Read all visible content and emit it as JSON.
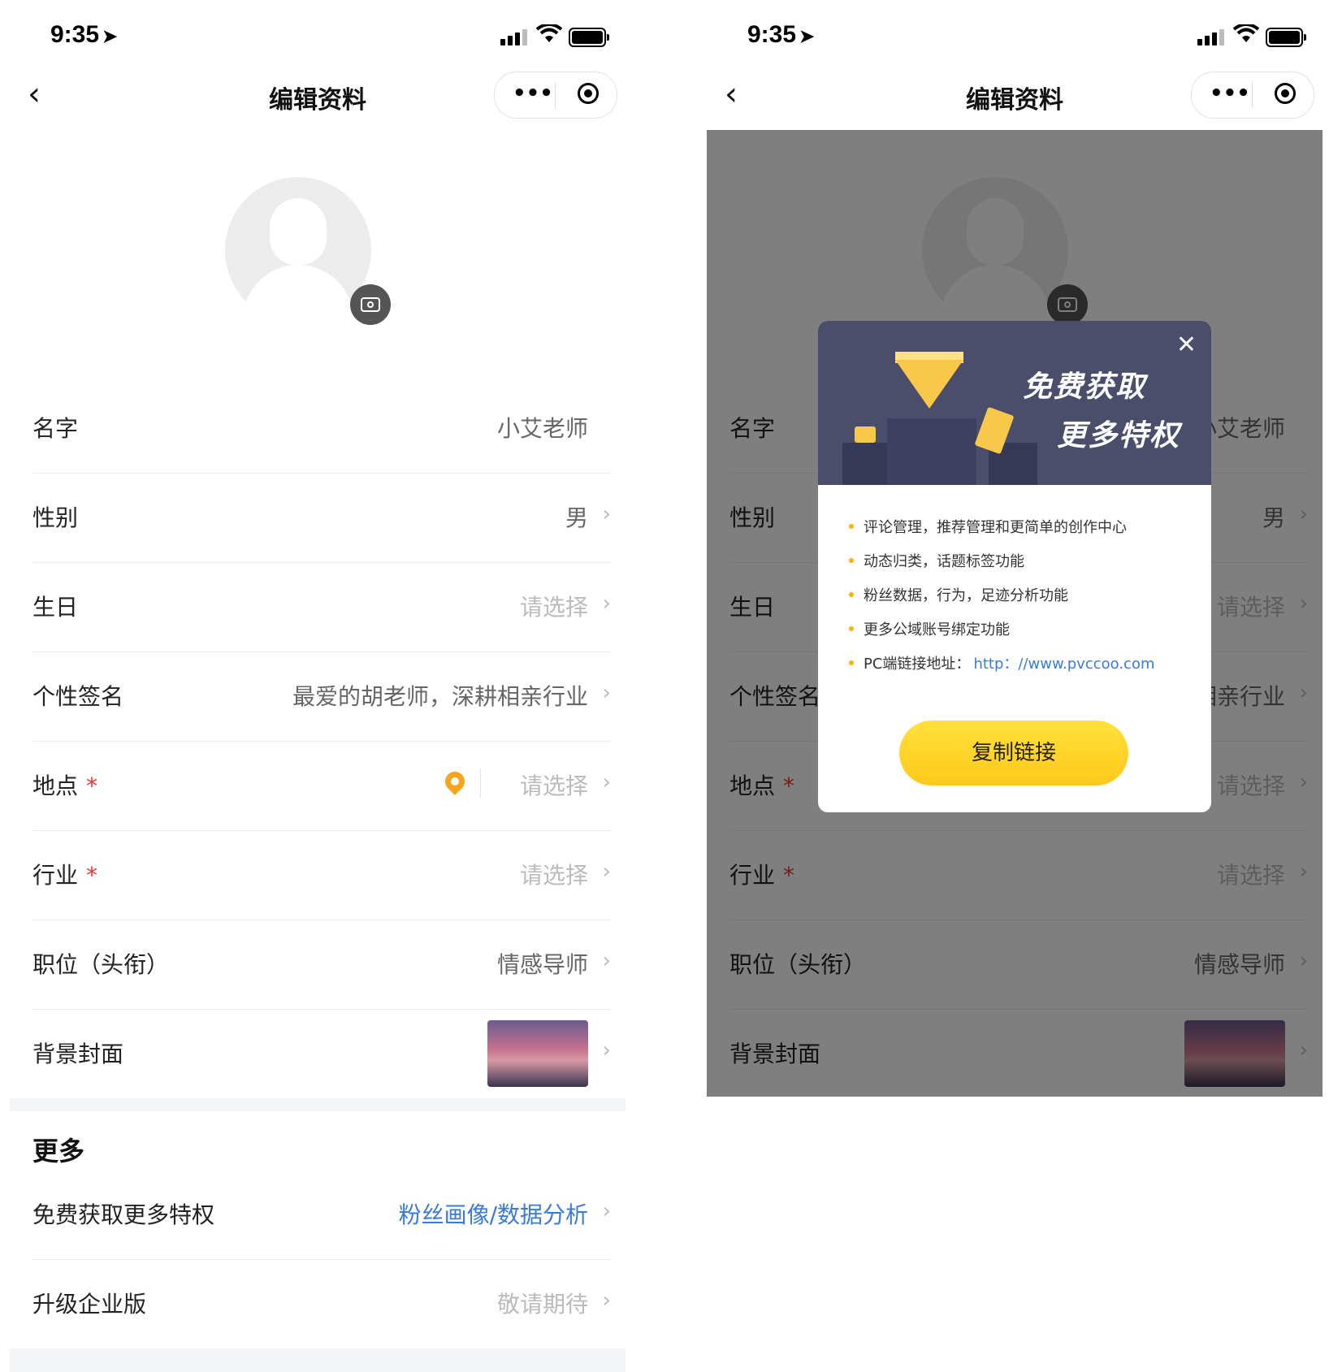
{
  "status_bar": {
    "time": "9:35"
  },
  "navbar": {
    "title": "编辑资料"
  },
  "profile": {
    "rows": [
      {
        "label": "名字",
        "value": "小艾老师"
      },
      {
        "label": "性别",
        "value": "男"
      },
      {
        "label": "生日",
        "value": "请选择"
      },
      {
        "label": "个性签名",
        "value": "最爱的胡老师，深耕相亲行业"
      },
      {
        "label": "地点",
        "required": "*",
        "value": "请选择"
      },
      {
        "label": "行业",
        "required": "*",
        "value": "请选择"
      },
      {
        "label": "职位（头衔）",
        "value": "情感导师"
      },
      {
        "label": "背景封面"
      }
    ]
  },
  "more": {
    "title": "更多",
    "rows": [
      {
        "label": "免费获取更多特权",
        "value": "粉丝画像/数据分析"
      },
      {
        "label": "升级企业版",
        "value": "敬请期待"
      }
    ]
  },
  "modal": {
    "headline_1": "免费获取",
    "headline_2": "更多特权",
    "features": [
      "评论管理，推荐管理和更简单的创作中心",
      "动态归类，话题标签功能",
      "粉丝数据，行为，足迹分析功能",
      "更多公域账号绑定功能"
    ],
    "pc_label": "PC端链接地址：",
    "pc_url": "http：//www.pvccoo.com",
    "copy_button": "复制链接"
  },
  "icons": {
    "back": "chevron-left-icon",
    "more": "more-dots-icon",
    "target": "target-icon",
    "camera": "camera-icon",
    "location": "location-pin-icon",
    "chevron": "chevron-right-icon",
    "close": "close-icon"
  },
  "colors": {
    "required": "#e33333",
    "link": "#3a7bd5",
    "placeholder": "#bbbbbb",
    "accent_yellow": "#ffc81a",
    "banner": "#4a4e6b"
  }
}
